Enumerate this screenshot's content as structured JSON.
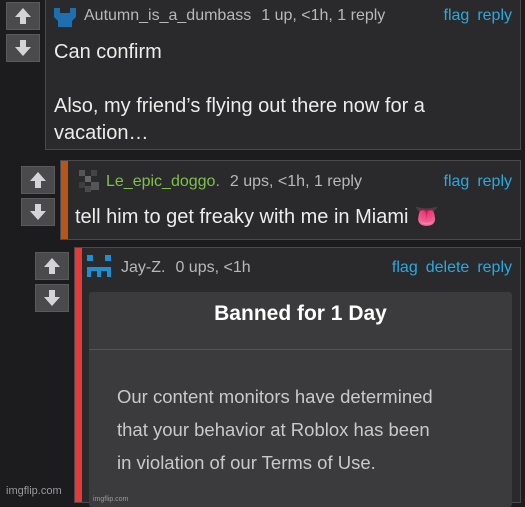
{
  "comments": [
    {
      "username": "Autumn_is_a_dumbass",
      "stats": "1 up, <1h, 1 reply",
      "actions": [
        "flag",
        "reply"
      ],
      "body": [
        "Can confirm",
        "",
        "Also, my friend’s flying out there now for a",
        "vacation…"
      ],
      "username_color": "#b8b8b8",
      "accent_color": null
    },
    {
      "username": "Le_epic_doggo.",
      "stats": "2 ups, <1h, 1 reply",
      "actions": [
        "flag",
        "reply"
      ],
      "body": [
        "tell him to get freaky with me in Miami 👅"
      ],
      "username_color": "#7ec24a",
      "accent_color": "#b8561a"
    },
    {
      "username": "Jay-Z.",
      "stats": "0 ups, <1h",
      "actions": [
        "flag",
        "delete",
        "reply"
      ],
      "username_color": "#b8b8b8",
      "accent_color": "#e43a3a",
      "image": {
        "title": "Banned for 1 Day",
        "body": [
          "Our content monitors have determined",
          "that your behavior at Roblox has been",
          "in violation of our Terms of Use."
        ],
        "watermark": "imgflip.com"
      }
    }
  ],
  "icons": {
    "upvote": "arrow-up-icon",
    "downvote": "arrow-down-icon"
  },
  "footer_watermark": "imgflip.com",
  "colors": {
    "background": "#1c1c1e",
    "card": "#2a2a2c",
    "link": "#2aa9e0",
    "text": "#ececec"
  }
}
